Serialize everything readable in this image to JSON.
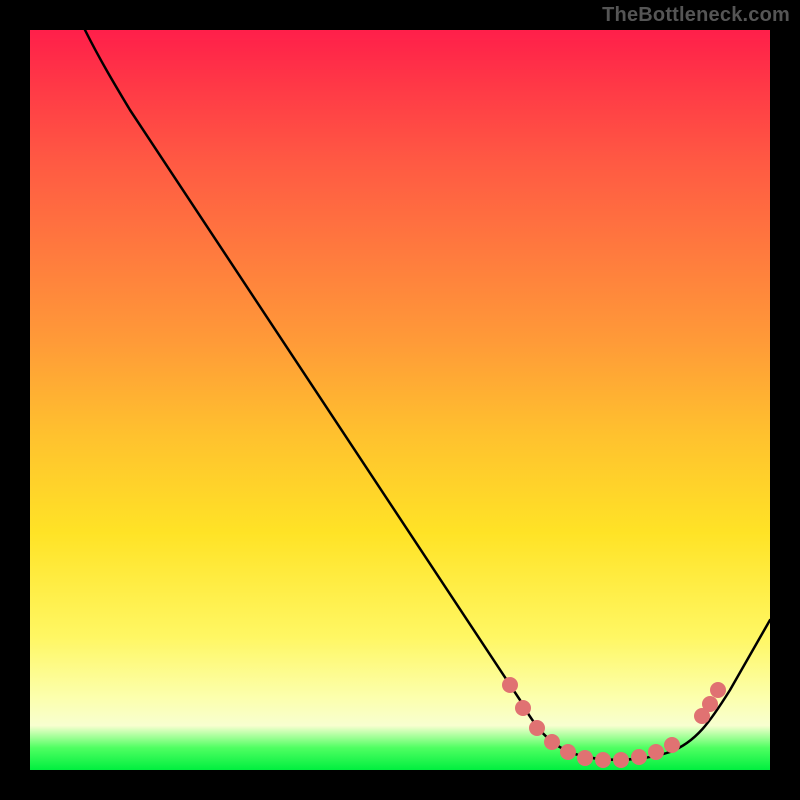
{
  "watermark": "TheBottleneck.com",
  "colors": {
    "gradient_top": "#ff1f4a",
    "gradient_mid": "#ffe326",
    "gradient_bottom": "#00ef3f",
    "curve": "#000000",
    "highlight": "#e07272",
    "background": "#000000"
  },
  "chart_data": {
    "type": "line",
    "title": "",
    "xlabel": "",
    "ylabel": "",
    "xlim": [
      0,
      100
    ],
    "ylim": [
      0,
      100
    ],
    "grid": false,
    "legend": false,
    "background_gradient": {
      "direction": "vertical",
      "stops": [
        {
          "pos": 0.0,
          "color": "#ff1f4a"
        },
        {
          "pos": 0.3,
          "color": "#ff7a3e"
        },
        {
          "pos": 0.55,
          "color": "#ffc22e"
        },
        {
          "pos": 0.82,
          "color": "#fff763"
        },
        {
          "pos": 0.94,
          "color": "#f8ffd0"
        },
        {
          "pos": 1.0,
          "color": "#00ef3f"
        }
      ]
    },
    "series": [
      {
        "name": "bottleneck-curve",
        "color": "#000000",
        "x": [
          7,
          14,
          66,
          74,
          80,
          86,
          93,
          100
        ],
        "y": [
          100,
          89,
          9,
          2,
          1,
          3,
          11,
          20
        ]
      },
      {
        "name": "optimal-range-highlight",
        "color": "#e07272",
        "style": "dotted-thick",
        "x": [
          65,
          67,
          69,
          71,
          73,
          75,
          77.5,
          80,
          82.5,
          85,
          87,
          91,
          92,
          93
        ],
        "y": [
          11,
          8,
          6,
          4,
          2,
          2,
          1.5,
          1,
          1.4,
          2,
          3,
          7,
          9,
          11
        ]
      }
    ],
    "annotations": []
  }
}
